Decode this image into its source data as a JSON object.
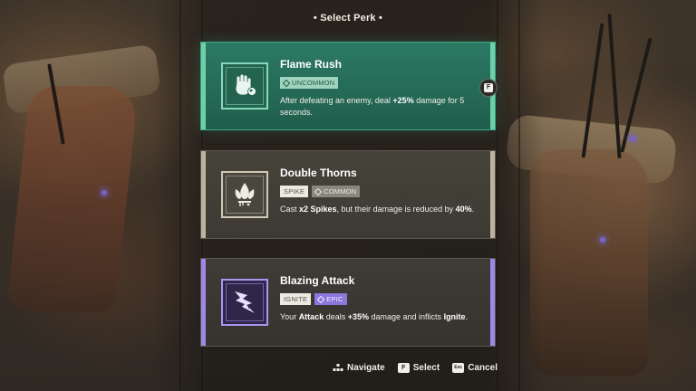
{
  "header": {
    "title": "• Select Perk •"
  },
  "perks": [
    {
      "name": "Flame Rush",
      "rarity": "UNCOMMON",
      "rarity_color": "#9fd3be",
      "keyword": null,
      "icon": "fist-orb-icon",
      "description_parts": [
        "After defeating an enemy, deal ",
        "+25%",
        " damage for 5 seconds."
      ],
      "selected": true,
      "select_key": "F"
    },
    {
      "name": "Double Thorns",
      "rarity": "COMMON",
      "rarity_color": "#8b877c",
      "keyword": "SPIKE",
      "icon": "thorns-icon",
      "description_parts": [
        "Cast ",
        "x2 Spikes",
        ", but their damage is reduced by ",
        "40%",
        "."
      ],
      "selected": false
    },
    {
      "name": "Blazing Attack",
      "rarity": "EPIC",
      "rarity_color": "#8a78dc",
      "keyword": "IGNITE",
      "icon": "blade-strike-icon",
      "description_parts": [
        "Your ",
        "Attack",
        " deals ",
        "+35%",
        " damage and inflicts ",
        "Ignite",
        "."
      ],
      "selected": false
    }
  ],
  "controls": {
    "navigate_label": "Navigate",
    "select_key": "F",
    "select_label": "Select",
    "cancel_key": "Esc",
    "cancel_label": "Cancel"
  },
  "colors": {
    "uncommon_accent": "#6dd0ab",
    "common_accent": "#bbb3a0",
    "epic_accent": "#9c88e8"
  }
}
